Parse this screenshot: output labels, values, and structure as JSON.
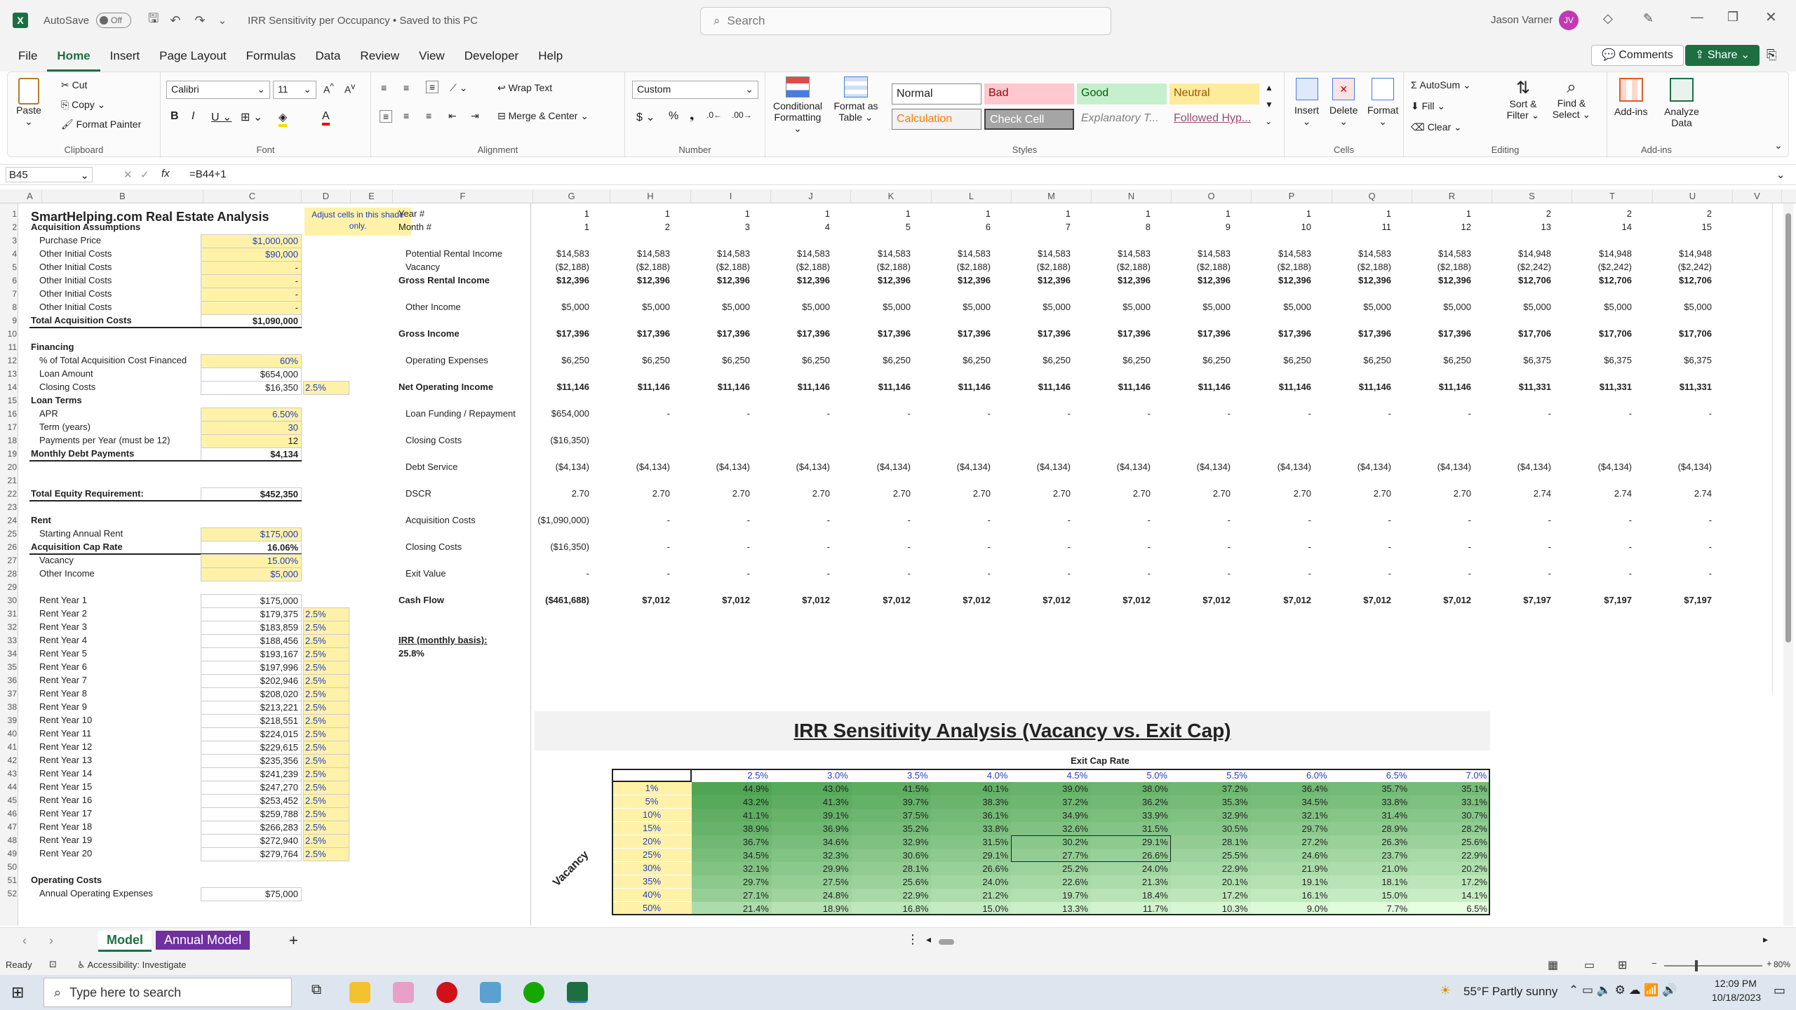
{
  "titlebar": {
    "autosave_label": "AutoSave",
    "autosave_state": "Off",
    "doc_title": "IRR Sensitivity per Occupancy • Saved to this PC",
    "search_placeholder": "Search",
    "user_name": "Jason Varner",
    "user_initials": "JV"
  },
  "menu": [
    "File",
    "Home",
    "Insert",
    "Page Layout",
    "Formulas",
    "Data",
    "Review",
    "View",
    "Developer",
    "Help"
  ],
  "menu_right": {
    "comments": "Comments",
    "share": "Share"
  },
  "ribbon": {
    "clipboard": {
      "paste": "Paste",
      "cut": "Cut",
      "copy": "Copy",
      "format_painter": "Format Painter",
      "label": "Clipboard"
    },
    "font": {
      "family": "Calibri",
      "size": "11",
      "label": "Font"
    },
    "alignment": {
      "wrap": "Wrap Text",
      "merge": "Merge & Center",
      "label": "Alignment"
    },
    "number": {
      "format": "Custom",
      "label": "Number"
    },
    "styles": {
      "conditional": "Conditional Formatting",
      "format_table": "Format as Table",
      "normal": "Normal",
      "bad": "Bad",
      "good": "Good",
      "neutral": "Neutral",
      "calculation": "Calculation",
      "check": "Check Cell",
      "explanatory": "Explanatory T...",
      "followed": "Followed Hyp...",
      "label": "Styles"
    },
    "cells": {
      "insert": "Insert",
      "delete": "Delete",
      "format": "Format",
      "label": "Cells"
    },
    "editing": {
      "autosum": "AutoSum",
      "fill": "Fill",
      "clear": "Clear",
      "sort": "Sort & Filter",
      "find": "Find & Select",
      "label": "Editing"
    },
    "addins": {
      "addins": "Add-ins",
      "analyze": "Analyze Data",
      "label": "Add-ins"
    }
  },
  "formula_bar": {
    "name_box": "B45",
    "formula": "=B44+1"
  },
  "columns": [
    "A",
    "B",
    "C",
    "D",
    "E",
    "F",
    "G",
    "H",
    "I",
    "J",
    "K",
    "L",
    "M",
    "N",
    "O",
    "P",
    "Q",
    "R",
    "S",
    "T",
    "U",
    "V"
  ],
  "left_panel": {
    "title": "SmartHelping.com Real Estate Analysis",
    "note": "Adjust cells in this shade only.",
    "rows": [
      {
        "r": "2",
        "label": "Acquisition Assumptions",
        "bold": true
      },
      {
        "r": "3",
        "label": "Purchase Price",
        "val": "$1,000,000",
        "yellow": true,
        "blue": true
      },
      {
        "r": "4",
        "label": "Other Initial Costs",
        "val": "$90,000",
        "yellow": true,
        "blue": true
      },
      {
        "r": "5",
        "label": "Other Initial Costs",
        "val": "-",
        "yellow": true
      },
      {
        "r": "6",
        "label": "Other Initial Costs",
        "val": "-",
        "yellow": true
      },
      {
        "r": "7",
        "label": "Other Initial Costs",
        "val": "-",
        "yellow": true
      },
      {
        "r": "8",
        "label": "Other Initial Costs",
        "val": "-",
        "yellow": true
      },
      {
        "r": "9",
        "label": "Total Acquisition Costs",
        "val": "$1,090,000",
        "bold": true
      },
      {
        "r": "10",
        "label": ""
      },
      {
        "r": "11",
        "label": "Financing",
        "bold": true
      },
      {
        "r": "12",
        "label": "% of Total Acquisition Cost Financed",
        "val": "60%",
        "yellow": true,
        "blue": true
      },
      {
        "r": "13",
        "label": "Loan Amount",
        "val": "$654,000"
      },
      {
        "r": "14",
        "label": "Closing Costs",
        "val": "$16,350",
        "pct": "2.5%"
      },
      {
        "r": "15",
        "label": "Loan Terms",
        "bold": true
      },
      {
        "r": "16",
        "label": "APR",
        "val": "6.50%",
        "yellow": true,
        "blue": true
      },
      {
        "r": "17",
        "label": "Term (years)",
        "val": "30",
        "yellow": true,
        "blue": true
      },
      {
        "r": "18",
        "label": "Payments per Year (must be 12)",
        "val": "12",
        "yellow": true
      },
      {
        "r": "19",
        "label": "Monthly Debt Payments",
        "val": "$4,134",
        "bold": true
      },
      {
        "r": "20",
        "label": ""
      },
      {
        "r": "21",
        "label": ""
      },
      {
        "r": "22",
        "label": "Total Equity Requirement:",
        "val": "$452,350",
        "bold": true
      },
      {
        "r": "23",
        "label": ""
      },
      {
        "r": "24",
        "label": "Rent",
        "bold": true
      },
      {
        "r": "25",
        "label": "Starting Annual Rent",
        "val": "$175,000",
        "yellow": true,
        "blue": true
      },
      {
        "r": "26",
        "label": "Acquisition Cap Rate",
        "val": "16.06%",
        "bold": true
      },
      {
        "r": "27",
        "label": "Vacancy",
        "val": "15.00%",
        "yellow": true,
        "blue": true
      },
      {
        "r": "28",
        "label": "Other Income",
        "val": "$5,000",
        "yellow": true,
        "blue": true
      },
      {
        "r": "29",
        "label": ""
      },
      {
        "r": "30",
        "label": "Rent Year 1",
        "val": "$175,000"
      },
      {
        "r": "31",
        "label": "Rent Year 2",
        "val": "$179,375",
        "pct": "2.5%"
      },
      {
        "r": "32",
        "label": "Rent Year 3",
        "val": "$183,859",
        "pct": "2.5%"
      },
      {
        "r": "33",
        "label": "Rent Year 4",
        "val": "$188,456",
        "pct": "2.5%"
      },
      {
        "r": "34",
        "label": "Rent Year 5",
        "val": "$193,167",
        "pct": "2.5%"
      },
      {
        "r": "35",
        "label": "Rent Year 6",
        "val": "$197,996",
        "pct": "2.5%"
      },
      {
        "r": "36",
        "label": "Rent Year 7",
        "val": "$202,946",
        "pct": "2.5%"
      },
      {
        "r": "37",
        "label": "Rent Year 8",
        "val": "$208,020",
        "pct": "2.5%"
      },
      {
        "r": "38",
        "label": "Rent Year 9",
        "val": "$213,221",
        "pct": "2.5%"
      },
      {
        "r": "39",
        "label": "Rent Year 10",
        "val": "$218,551",
        "pct": "2.5%"
      },
      {
        "r": "40",
        "label": "Rent Year 11",
        "val": "$224,015",
        "pct": "2.5%"
      },
      {
        "r": "41",
        "label": "Rent Year 12",
        "val": "$229,615",
        "pct": "2.5%"
      },
      {
        "r": "42",
        "label": "Rent Year 13",
        "val": "$235,356",
        "pct": "2.5%"
      },
      {
        "r": "43",
        "label": "Rent Year 14",
        "val": "$241,239",
        "pct": "2.5%"
      },
      {
        "r": "44",
        "label": "Rent Year 15",
        "val": "$247,270",
        "pct": "2.5%"
      },
      {
        "r": "45",
        "label": "Rent Year 16",
        "val": "$253,452",
        "pct": "2.5%"
      },
      {
        "r": "46",
        "label": "Rent Year 17",
        "val": "$259,788",
        "pct": "2.5%"
      },
      {
        "r": "47",
        "label": "Rent Year 18",
        "val": "$266,283",
        "pct": "2.5%"
      },
      {
        "r": "48",
        "label": "Rent Year 19",
        "val": "$272,940",
        "pct": "2.5%"
      },
      {
        "r": "49",
        "label": "Rent Year 20",
        "val": "$279,764",
        "pct": "2.5%"
      },
      {
        "r": "50",
        "label": ""
      },
      {
        "r": "51",
        "label": "Operating Costs",
        "bold": true
      },
      {
        "r": "52",
        "label": "Annual Operating Expenses",
        "val": "$75,000"
      }
    ]
  },
  "cashflow": {
    "col_letters": [
      "G",
      "H",
      "I",
      "J",
      "K",
      "L",
      "M",
      "N",
      "O",
      "P",
      "Q",
      "R",
      "S",
      "T",
      "U"
    ],
    "year_label": "Year #",
    "month_label": "Month #",
    "years": [
      "1",
      "1",
      "1",
      "1",
      "1",
      "1",
      "1",
      "1",
      "1",
      "1",
      "1",
      "1",
      "2",
      "2",
      "2"
    ],
    "months": [
      "1",
      "2",
      "3",
      "4",
      "5",
      "6",
      "7",
      "8",
      "9",
      "10",
      "11",
      "12",
      "13",
      "14",
      "15"
    ],
    "lines": [
      {
        "label": "Potential Rental Income",
        "vals": [
          "$14,583",
          "$14,583",
          "$14,583",
          "$14,583",
          "$14,583",
          "$14,583",
          "$14,583",
          "$14,583",
          "$14,583",
          "$14,583",
          "$14,583",
          "$14,583",
          "$14,948",
          "$14,948",
          "$14,948"
        ]
      },
      {
        "label": "Vacancy",
        "vals": [
          "($2,188)",
          "($2,188)",
          "($2,188)",
          "($2,188)",
          "($2,188)",
          "($2,188)",
          "($2,188)",
          "($2,188)",
          "($2,188)",
          "($2,188)",
          "($2,188)",
          "($2,188)",
          "($2,242)",
          "($2,242)",
          "($2,242)"
        ]
      },
      {
        "label": "Gross Rental Income",
        "bold": true,
        "vals": [
          "$12,396",
          "$12,396",
          "$12,396",
          "$12,396",
          "$12,396",
          "$12,396",
          "$12,396",
          "$12,396",
          "$12,396",
          "$12,396",
          "$12,396",
          "$12,396",
          "$12,706",
          "$12,706",
          "$12,706"
        ]
      },
      {
        "label": "Other Income",
        "vals": [
          "$5,000",
          "$5,000",
          "$5,000",
          "$5,000",
          "$5,000",
          "$5,000",
          "$5,000",
          "$5,000",
          "$5,000",
          "$5,000",
          "$5,000",
          "$5,000",
          "$5,000",
          "$5,000",
          "$5,000"
        ]
      },
      {
        "label": "Gross Income",
        "bold": true,
        "vals": [
          "$17,396",
          "$17,396",
          "$17,396",
          "$17,396",
          "$17,396",
          "$17,396",
          "$17,396",
          "$17,396",
          "$17,396",
          "$17,396",
          "$17,396",
          "$17,396",
          "$17,706",
          "$17,706",
          "$17,706"
        ]
      },
      {
        "label": "Operating Expenses",
        "vals": [
          "$6,250",
          "$6,250",
          "$6,250",
          "$6,250",
          "$6,250",
          "$6,250",
          "$6,250",
          "$6,250",
          "$6,250",
          "$6,250",
          "$6,250",
          "$6,250",
          "$6,375",
          "$6,375",
          "$6,375"
        ]
      },
      {
        "label": "Net Operating Income",
        "bold": true,
        "vals": [
          "$11,146",
          "$11,146",
          "$11,146",
          "$11,146",
          "$11,146",
          "$11,146",
          "$11,146",
          "$11,146",
          "$11,146",
          "$11,146",
          "$11,146",
          "$11,146",
          "$11,331",
          "$11,331",
          "$11,331"
        ]
      },
      {
        "label": "Loan Funding / Repayment",
        "vals": [
          "$654,000",
          "-",
          "-",
          "-",
          "-",
          "-",
          "-",
          "-",
          "-",
          "-",
          "-",
          "-",
          "-",
          "-",
          "-"
        ]
      },
      {
        "label": "Closing Costs",
        "vals": [
          "($16,350)",
          "",
          "",
          "",
          "",
          "",
          "",
          "",
          "",
          "",
          "",
          "",
          "",
          "",
          ""
        ]
      },
      {
        "label": "Debt Service",
        "vals": [
          "($4,134)",
          "($4,134)",
          "($4,134)",
          "($4,134)",
          "($4,134)",
          "($4,134)",
          "($4,134)",
          "($4,134)",
          "($4,134)",
          "($4,134)",
          "($4,134)",
          "($4,134)",
          "($4,134)",
          "($4,134)",
          "($4,134)"
        ]
      },
      {
        "label": "DSCR",
        "vals": [
          "2.70",
          "2.70",
          "2.70",
          "2.70",
          "2.70",
          "2.70",
          "2.70",
          "2.70",
          "2.70",
          "2.70",
          "2.70",
          "2.70",
          "2.74",
          "2.74",
          "2.74"
        ]
      },
      {
        "label": "Acquisition Costs",
        "vals": [
          "($1,090,000)",
          "-",
          "-",
          "-",
          "-",
          "-",
          "-",
          "-",
          "-",
          "-",
          "-",
          "-",
          "-",
          "-",
          "-"
        ]
      },
      {
        "label": "Closing Costs",
        "vals": [
          "($16,350)",
          "-",
          "-",
          "-",
          "-",
          "-",
          "-",
          "-",
          "-",
          "-",
          "-",
          "-",
          "-",
          "-",
          "-"
        ]
      },
      {
        "label": "Exit Value",
        "vals": [
          "-",
          "-",
          "-",
          "-",
          "-",
          "-",
          "-",
          "-",
          "-",
          "-",
          "-",
          "-",
          "-",
          "-",
          "-"
        ]
      },
      {
        "label": "Cash Flow",
        "bold": true,
        "vals": [
          "($461,688)",
          "$7,012",
          "$7,012",
          "$7,012",
          "$7,012",
          "$7,012",
          "$7,012",
          "$7,012",
          "$7,012",
          "$7,012",
          "$7,012",
          "$7,012",
          "$7,197",
          "$7,197",
          "$7,197"
        ]
      }
    ],
    "irr_label": "IRR (monthly basis):",
    "irr_value": "25.8%"
  },
  "sensitivity": {
    "title": "IRR Sensitivity Analysis (Vacancy vs. Exit Cap)",
    "col_title": "Exit Cap Rate",
    "row_title": "Vacancy",
    "caps": [
      "2.5%",
      "3.0%",
      "3.5%",
      "4.0%",
      "4.5%",
      "5.0%",
      "5.5%",
      "6.0%",
      "6.5%",
      "7.0%"
    ],
    "vacancies": [
      "1%",
      "5%",
      "10%",
      "15%",
      "20%",
      "25%",
      "30%",
      "35%",
      "40%",
      "50%"
    ],
    "values": [
      [
        "44.9%",
        "43.0%",
        "41.5%",
        "40.1%",
        "39.0%",
        "38.0%",
        "37.2%",
        "36.4%",
        "35.7%",
        "35.1%"
      ],
      [
        "43.2%",
        "41.3%",
        "39.7%",
        "38.3%",
        "37.2%",
        "36.2%",
        "35.3%",
        "34.5%",
        "33.8%",
        "33.1%"
      ],
      [
        "41.1%",
        "39.1%",
        "37.5%",
        "36.1%",
        "34.9%",
        "33.9%",
        "32.9%",
        "32.1%",
        "31.4%",
        "30.7%"
      ],
      [
        "38.9%",
        "36.9%",
        "35.2%",
        "33.8%",
        "32.6%",
        "31.5%",
        "30.5%",
        "29.7%",
        "28.9%",
        "28.2%"
      ],
      [
        "36.7%",
        "34.6%",
        "32.9%",
        "31.5%",
        "30.2%",
        "29.1%",
        "28.1%",
        "27.2%",
        "26.3%",
        "25.6%"
      ],
      [
        "34.5%",
        "32.3%",
        "30.6%",
        "29.1%",
        "27.7%",
        "26.6%",
        "25.5%",
        "24.6%",
        "23.7%",
        "22.9%"
      ],
      [
        "32.1%",
        "29.9%",
        "28.1%",
        "26.6%",
        "25.2%",
        "24.0%",
        "22.9%",
        "21.9%",
        "21.0%",
        "20.2%"
      ],
      [
        "29.7%",
        "27.5%",
        "25.6%",
        "24.0%",
        "22.6%",
        "21.3%",
        "20.1%",
        "19.1%",
        "18.1%",
        "17.2%"
      ],
      [
        "27.1%",
        "24.8%",
        "22.9%",
        "21.2%",
        "19.7%",
        "18.4%",
        "17.2%",
        "16.1%",
        "15.0%",
        "14.1%"
      ],
      [
        "21.4%",
        "18.9%",
        "16.8%",
        "15.0%",
        "13.3%",
        "11.7%",
        "10.3%",
        "9.0%",
        "7.7%",
        "6.5%"
      ]
    ]
  },
  "sheet_tabs": {
    "tab1": "Model",
    "tab2": "Annual Model"
  },
  "status": {
    "ready": "Ready",
    "accessibility": "Accessibility: Investigate",
    "zoom": "80%"
  },
  "taskbar": {
    "search_placeholder": "Type here to search",
    "weather": "55°F  Partly sunny",
    "time": "12:09 PM",
    "date": "10/18/2023"
  }
}
